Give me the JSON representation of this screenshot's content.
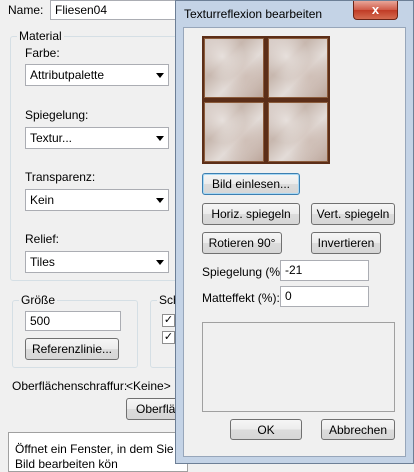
{
  "main": {
    "name_label": "Name:",
    "name_value": "Fliesen04",
    "material_title": "Material",
    "farbe_label": "Farbe:",
    "farbe_value": "Attributpalette",
    "spiegelung_label": "Spiegelung:",
    "spiegelung_value": "Textur...",
    "transparenz_label": "Transparenz:",
    "transparenz_value": "Kein",
    "relief_label": "Relief:",
    "relief_value": "Tiles",
    "groesse_title": "Größe",
    "groesse_value": "500",
    "referenzlinie_button": "Referenzlinie...",
    "schl_title": "Schl",
    "oberflaechenschraffur_label": "Oberflächenschraffur:",
    "oberflaechenschraffur_value": "<Keine>",
    "oberflaeche_button": "Oberfläch",
    "description_line1": "Öffnet ein Fenster, in dem Sie die",
    "description_line2": "Bild bearbeiten kön"
  },
  "dialog": {
    "title": "Texturreflexion bearbeiten",
    "close_glyph": "x",
    "bild_einlesen_button": "Bild einlesen...",
    "horiz_spiegeln_button": "Horiz. spiegeln",
    "vert_spiegeln_button": "Vert. spiegeln",
    "rotieren_button": "Rotieren 90°",
    "invertieren_button": "Invertieren",
    "spiegelung_label": "Spiegelung (%):",
    "spiegelung_value": "-21",
    "matteffekt_label": "Matteffekt (%):",
    "matteffekt_value": "0",
    "ok_button": "OK",
    "abbrechen_button": "Abbrechen"
  }
}
